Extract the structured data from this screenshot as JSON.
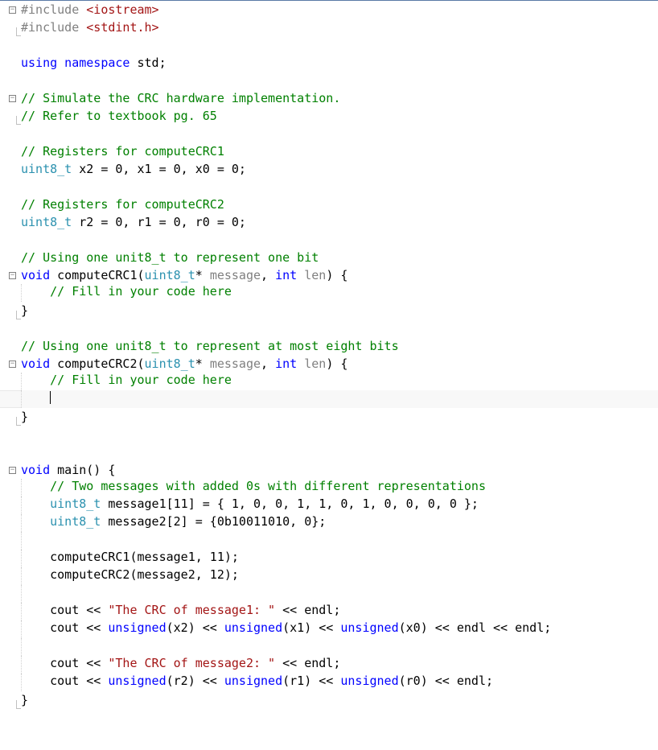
{
  "lines": {
    "l1a": "#include",
    "l1b": " <iostream>",
    "l2a": "#include",
    "l2b": " <stdint.h>",
    "l4a": "using",
    "l4b": " namespace",
    "l4c": " std;",
    "l6": "// Simulate the CRC hardware implementation.",
    "l7": "// Refer to textbook pg. 65",
    "l9": "// Registers for computeCRC1",
    "l10a": "uint8_t",
    "l10b": " x2 = 0, x1 = 0, x0 = 0;",
    "l12": "// Registers for computeCRC2",
    "l13a": "uint8_t",
    "l13b": " r2 = 0, r1 = 0, r0 = 0;",
    "l15": "// Using one unit8_t to represent one bit",
    "l16a": "void",
    "l16b": " computeCRC1(",
    "l16c": "uint8_t",
    "l16d": "* ",
    "l16e": "message",
    "l16f": ", ",
    "l16g": "int",
    "l16h": " ",
    "l16i": "len",
    "l16j": ") {",
    "l17": "// Fill in your code here",
    "l18": "}",
    "l20": "// Using one unit8_t to represent at most eight bits",
    "l21a": "void",
    "l21b": " computeCRC2(",
    "l21c": "uint8_t",
    "l21d": "* ",
    "l21e": "message",
    "l21f": ", ",
    "l21g": "int",
    "l21h": " ",
    "l21i": "len",
    "l21j": ") {",
    "l22": "// Fill in your code here",
    "l24": "}",
    "l27a": "void",
    "l27b": " main() {",
    "l28": "// Two messages with added 0s with different representations",
    "l29a": "uint8_t",
    "l29b": " message1[11] = { 1, 0, 0, 1, 1, 0, 1, 0, 0, 0, 0 };",
    "l30a": "uint8_t",
    "l30b": " message2[2] = {0b10011010, 0};",
    "l32": "computeCRC1(message1, 11);",
    "l33": "computeCRC2(message2, 12);",
    "l35a": "cout << ",
    "l35b": "\"The CRC of message1: \"",
    "l35c": " << endl;",
    "l36a": "cout << ",
    "l36b": "unsigned",
    "l36c": "(x2) << ",
    "l36d": "unsigned",
    "l36e": "(x1) << ",
    "l36f": "unsigned",
    "l36g": "(x0) << endl << endl;",
    "l38a": "cout << ",
    "l38b": "\"The CRC of message2: \"",
    "l38c": " << endl;",
    "l39a": "cout << ",
    "l39b": "unsigned",
    "l39c": "(r2) << ",
    "l39d": "unsigned",
    "l39e": "(r1) << ",
    "l39f": "unsigned",
    "l39g": "(r0) << endl;",
    "l40": "}"
  }
}
